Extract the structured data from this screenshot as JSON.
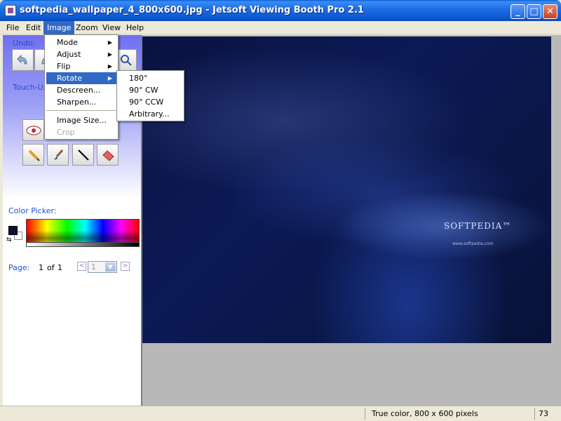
{
  "window": {
    "title": "softpedia_wallpaper_4_800x600.jpg - Jetsoft Viewing Booth Pro 2.1",
    "min_glyph": "_",
    "max_glyph": "□",
    "close_glyph": "✕"
  },
  "menubar": [
    "File",
    "Edit",
    "Image",
    "Zoom",
    "View",
    "Help"
  ],
  "image_menu": {
    "items": [
      {
        "label": "Mode",
        "submenu": true
      },
      {
        "label": "Adjust",
        "submenu": true
      },
      {
        "label": "Flip",
        "submenu": true
      },
      {
        "label": "Rotate",
        "submenu": true,
        "highlighted": true
      },
      {
        "label": "Descreen...",
        "submenu": false
      },
      {
        "label": "Sharpen...",
        "submenu": false
      },
      {
        "label": "Image Size...",
        "submenu": false
      },
      {
        "label": "Crop",
        "submenu": false,
        "disabled": true
      }
    ]
  },
  "rotate_submenu": {
    "items": [
      "180°",
      "90° CW",
      "90° CCW",
      "Arbitrary..."
    ]
  },
  "left_panel": {
    "undo_label": "Undo:",
    "touchup_label": "Touch-Up",
    "color_picker_label": "Color Picker:",
    "page_label": "Page:",
    "page_current": "1",
    "page_of": "of",
    "page_total": "1",
    "page_select_value": "1",
    "prev_glyph": "<",
    "next_glyph": ">",
    "dropdown_glyph": "▼",
    "swap_glyph": "⇆",
    "fg_color": "#0b1233",
    "bg_color": "#ffffff"
  },
  "wallpaper": {
    "logo_text": "SOFTPEDIA™",
    "url_text": "www.softpedia.com"
  },
  "statusbar": {
    "info": "True color, 800 x 600 pixels",
    "zoom": "73"
  }
}
